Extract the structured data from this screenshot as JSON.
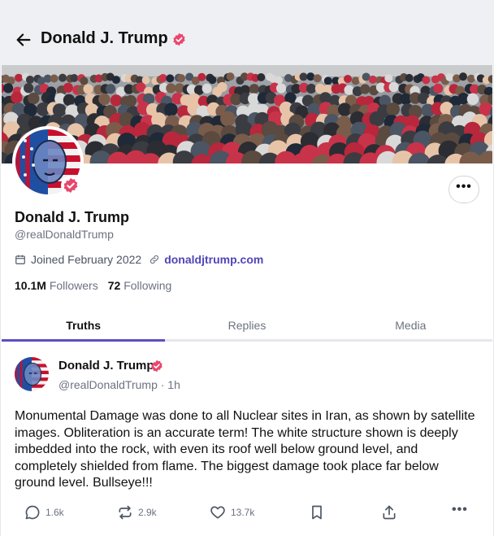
{
  "header": {
    "title": "Donald J. Trump",
    "back_icon": "arrow-left-icon",
    "verified_icon": "verified-badge-icon"
  },
  "profile": {
    "name": "Donald J. Trump",
    "handle": "@realDonaldTrump",
    "joined": "Joined February 2022",
    "website": "donaldjtrump.com",
    "followers_count": "10.1M",
    "followers_label": "Followers",
    "following_count": "72",
    "following_label": "Following",
    "more_icon": "more-horizontal-icon"
  },
  "tabs": [
    {
      "label": "Truths",
      "active": true
    },
    {
      "label": "Replies",
      "active": false
    },
    {
      "label": "Media",
      "active": false
    }
  ],
  "post": {
    "author": "Donald J. Trump",
    "handle_time": "@realDonaldTrump · 1h",
    "text": "Monumental Damage was done to all Nuclear sites in Iran, as shown by satellite images. Obliteration is an accurate term! The white structure shown is deeply imbedded into the rock, with even its roof well below ground level, and completely shielded from flame. The biggest damage took place far below ground level. Bullseye!!!",
    "replies": "1.6k",
    "retruths": "2.9k",
    "likes": "13.7k"
  },
  "colors": {
    "accent": "#5b4fc4",
    "verified": "#e8476d",
    "link": "#4f46b8"
  }
}
